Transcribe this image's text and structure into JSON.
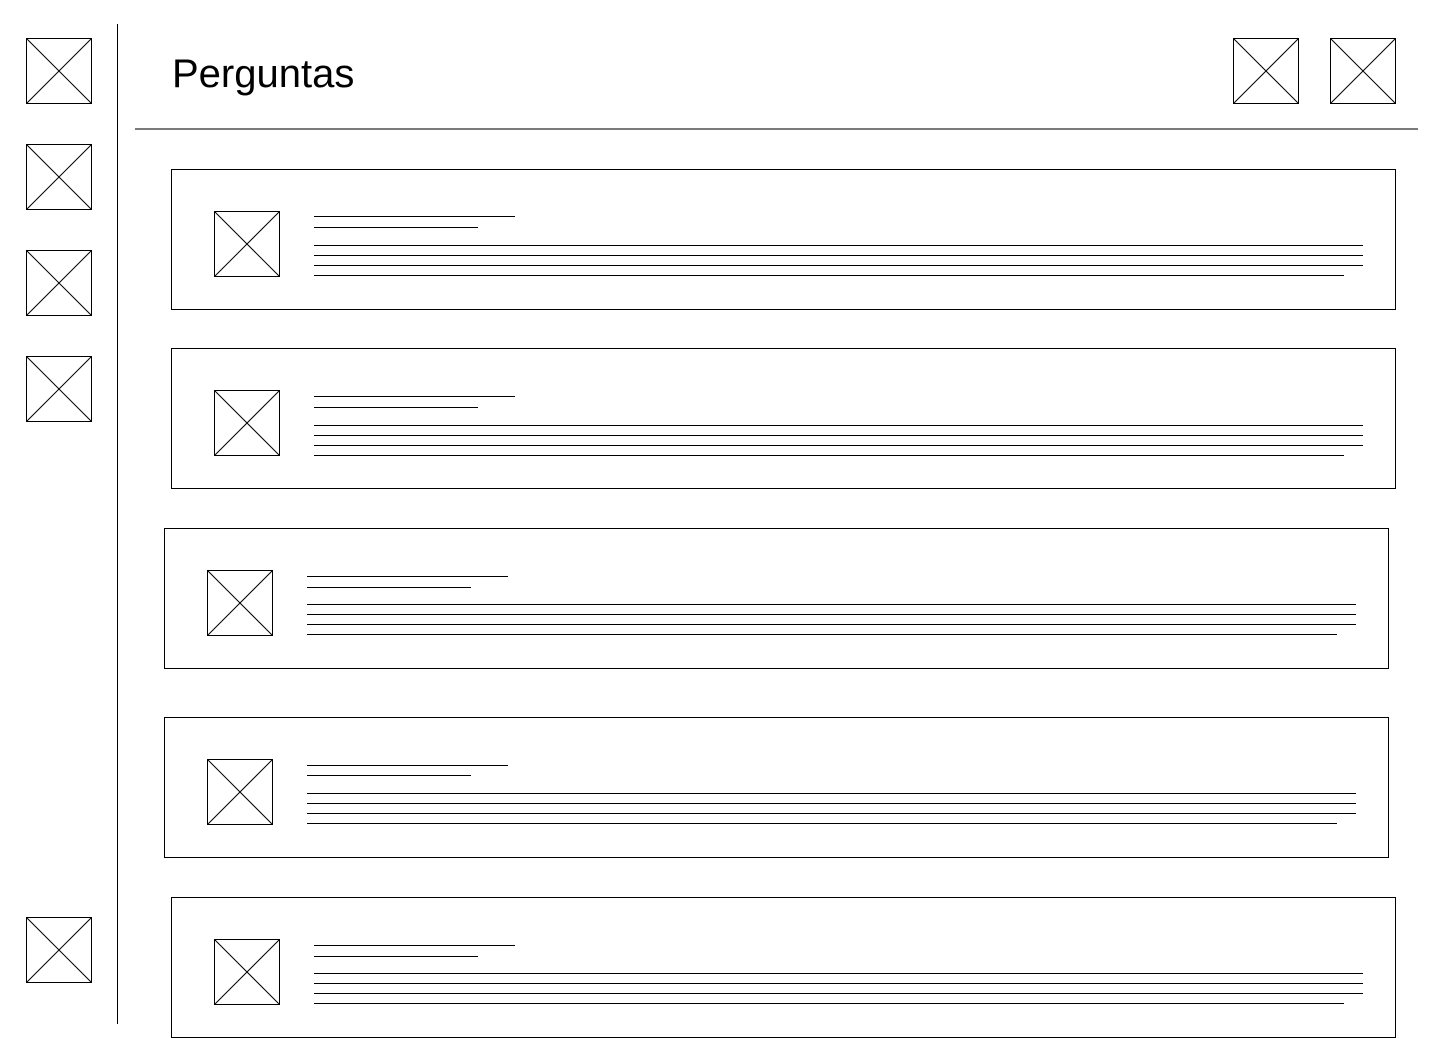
{
  "header": {
    "title": "Perguntas",
    "actions": [
      {
        "icon": "image-placeholder-icon"
      },
      {
        "icon": "image-placeholder-icon"
      }
    ]
  },
  "sidebar": {
    "items": [
      {
        "icon": "image-placeholder-icon"
      },
      {
        "icon": "image-placeholder-icon"
      },
      {
        "icon": "image-placeholder-icon"
      },
      {
        "icon": "image-placeholder-icon"
      }
    ],
    "bottom_item": {
      "icon": "image-placeholder-icon"
    }
  },
  "questions": [
    {
      "thumbnail": "image-placeholder-icon"
    },
    {
      "thumbnail": "image-placeholder-icon"
    },
    {
      "thumbnail": "image-placeholder-icon"
    },
    {
      "thumbnail": "image-placeholder-icon"
    },
    {
      "thumbnail": "image-placeholder-icon"
    }
  ]
}
